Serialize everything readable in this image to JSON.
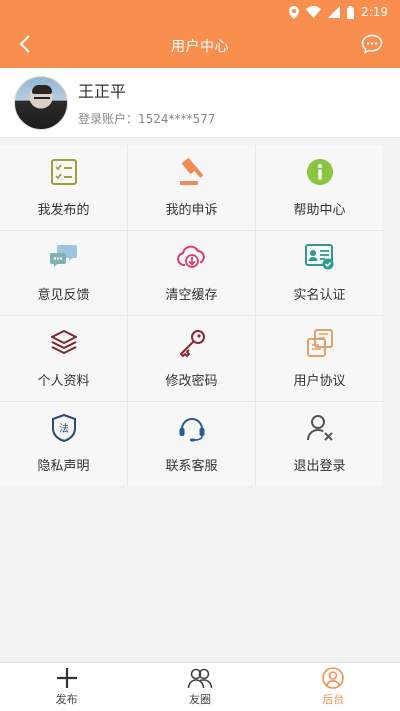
{
  "status_bar": {
    "time": "2:19"
  },
  "app_bar": {
    "title": "用户中心"
  },
  "profile": {
    "name": "王正平",
    "account": "登录账户：1524****577"
  },
  "grid": [
    {
      "label": "我发布的",
      "icon": "checklist-icon"
    },
    {
      "label": "我的申诉",
      "icon": "gavel-icon"
    },
    {
      "label": "帮助中心",
      "icon": "info-icon"
    },
    {
      "label": "意见反馈",
      "icon": "chat-bubbles-icon"
    },
    {
      "label": "清空缓存",
      "icon": "cloud-download-icon"
    },
    {
      "label": "实名认证",
      "icon": "id-card-icon"
    },
    {
      "label": "个人资料",
      "icon": "layers-icon"
    },
    {
      "label": "修改密码",
      "icon": "key-icon"
    },
    {
      "label": "用户协议",
      "icon": "agreement-icon"
    },
    {
      "label": "隐私声明",
      "icon": "law-shield-icon"
    },
    {
      "label": "联系客服",
      "icon": "headset-icon"
    },
    {
      "label": "退出登录",
      "icon": "user-remove-icon"
    }
  ],
  "bottom_nav": [
    {
      "label": "发布",
      "icon": "plus-icon"
    },
    {
      "label": "友圈",
      "icon": "friends-icon"
    },
    {
      "label": "后台",
      "icon": "user-circle-icon"
    }
  ],
  "colors": {
    "accent": "#f88f4f",
    "background": "#f2f2f2"
  }
}
